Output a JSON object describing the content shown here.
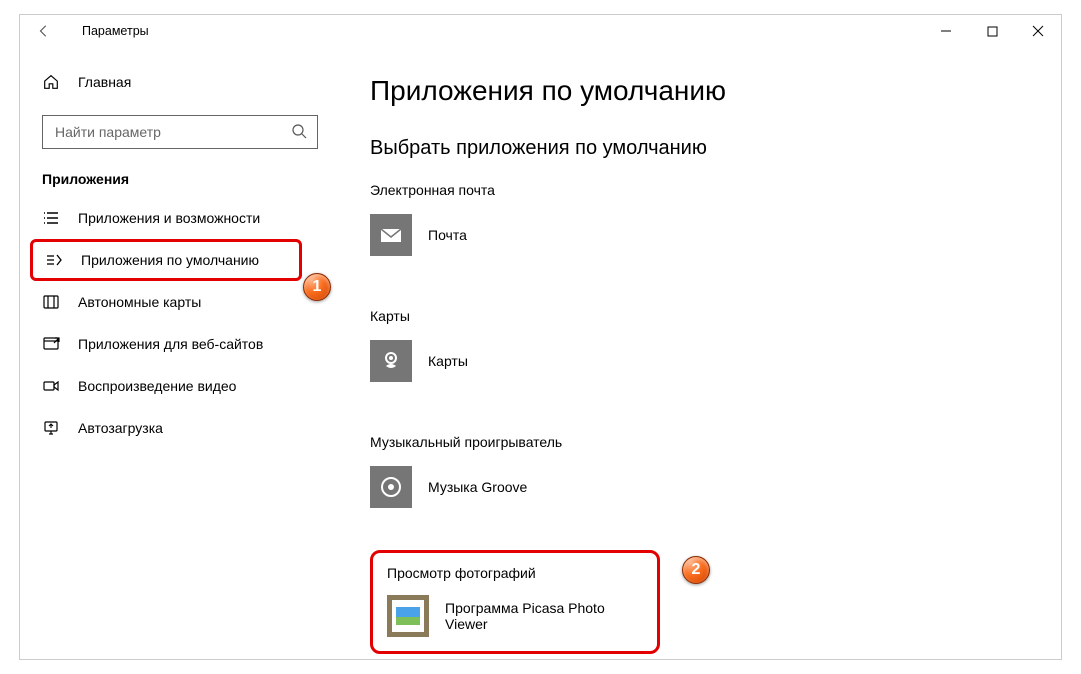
{
  "window": {
    "title": "Параметры"
  },
  "sidebar": {
    "home": "Главная",
    "search_placeholder": "Найти параметр",
    "section": "Приложения",
    "items": [
      {
        "label": "Приложения и возможности"
      },
      {
        "label": "Приложения по умолчанию"
      },
      {
        "label": "Автономные карты"
      },
      {
        "label": "Приложения для веб-сайтов"
      },
      {
        "label": "Воспроизведение видео"
      },
      {
        "label": "Автозагрузка"
      }
    ]
  },
  "main": {
    "title": "Приложения по умолчанию",
    "subtitle": "Выбрать приложения по умолчанию",
    "categories": [
      {
        "label": "Электронная почта",
        "app": "Почта"
      },
      {
        "label": "Карты",
        "app": "Карты"
      },
      {
        "label": "Музыкальный проигрыватель",
        "app": "Музыка Groove"
      },
      {
        "label": "Просмотр фотографий",
        "app": "Программа Picasa Photo Viewer"
      }
    ]
  },
  "badges": {
    "one": "1",
    "two": "2"
  }
}
